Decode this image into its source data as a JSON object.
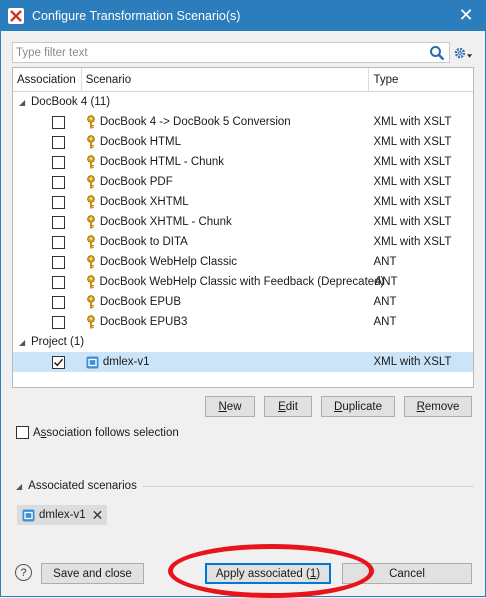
{
  "window": {
    "title": "Configure Transformation Scenario(s)",
    "close_glyph": "✕"
  },
  "filter": {
    "placeholder": "Type filter text"
  },
  "table": {
    "columns": [
      "Association",
      "Scenario",
      "Type"
    ],
    "groups": [
      {
        "label": "DocBook 4 (11)",
        "rows": [
          {
            "name": "DocBook 4 -> DocBook 5 Conversion",
            "type": "XML with XSLT",
            "checked": false
          },
          {
            "name": "DocBook HTML",
            "type": "XML with XSLT",
            "checked": false
          },
          {
            "name": "DocBook HTML - Chunk",
            "type": "XML with XSLT",
            "checked": false
          },
          {
            "name": "DocBook PDF",
            "type": "XML with XSLT",
            "checked": false
          },
          {
            "name": "DocBook XHTML",
            "type": "XML with XSLT",
            "checked": false
          },
          {
            "name": "DocBook XHTML - Chunk",
            "type": "XML with XSLT",
            "checked": false
          },
          {
            "name": "DocBook to DITA",
            "type": "XML with XSLT",
            "checked": false
          },
          {
            "name": "DocBook WebHelp Classic",
            "type": "ANT",
            "checked": false
          },
          {
            "name": "DocBook WebHelp Classic with Feedback (Deprecated)",
            "type": "ANT",
            "checked": false
          },
          {
            "name": "DocBook EPUB",
            "type": "ANT",
            "checked": false
          },
          {
            "name": "DocBook EPUB3",
            "type": "ANT",
            "checked": false
          }
        ]
      },
      {
        "label": "Project (1)",
        "rows": [
          {
            "name": "dmlex-v1",
            "type": "XML with XSLT",
            "checked": true,
            "selected": true
          }
        ]
      }
    ]
  },
  "actions": {
    "new": {
      "u": "N",
      "rest": "ew"
    },
    "edit": {
      "u": "E",
      "rest": "dit"
    },
    "duplicate": {
      "u": "D",
      "rest": "uplicate"
    },
    "remove": {
      "u": "R",
      "rest": "emove"
    }
  },
  "follow": {
    "pre": "A",
    "u": "s",
    "rest": "sociation follows selection"
  },
  "associated": {
    "label": "Associated scenarios",
    "chip": "dmlex-v1"
  },
  "footer": {
    "help": "?",
    "save_close": "Save and close",
    "apply_pre": "Apply associated (",
    "apply_u": "1",
    "apply_post": ")",
    "cancel": "Cancel"
  },
  "colors": {
    "accent": "#2b7dbb",
    "selection": "#cce4f7",
    "annotation": "#e8141c"
  }
}
